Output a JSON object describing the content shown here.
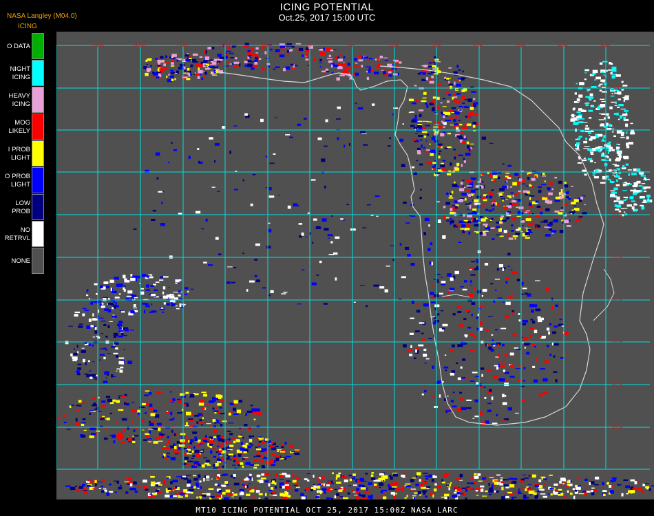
{
  "header": {
    "title": "ICING POTENTIAL",
    "subtitle": "Oct.25, 2017 15:00 UTC",
    "producer": "NASA Langley (M04.0)"
  },
  "legend": {
    "title": "ICING",
    "items": [
      {
        "label": "O DATA",
        "color": "#00b000"
      },
      {
        "label": "NIGHT\nICING",
        "color": "#00ffff"
      },
      {
        "label": "HEAVY\nICING",
        "color": "#e8a0d8"
      },
      {
        "label": "MOG\nLIKELY",
        "color": "#ff0000"
      },
      {
        "label": "I PROB\nLIGHT",
        "color": "#ffff00"
      },
      {
        "label": "O PROB\nLIGHT",
        "color": "#0000ff"
      },
      {
        "label": "LOW\nPROB",
        "color": "#000080"
      },
      {
        "label": "NO\nRETRVL",
        "color": "#ffffff"
      },
      {
        "label": "NONE",
        "color": "#505050"
      }
    ]
  },
  "map": {
    "background": "#505050",
    "grid_color": "#00e0e0",
    "coast_color": "#d8d8d8",
    "top_labels": [
      "25W",
      "20W",
      "15W",
      "10W",
      "5W",
      "0",
      "5E",
      "10E",
      "15E",
      "20E",
      "25E",
      "30E",
      "35E"
    ],
    "right_labels": [
      "5N",
      "0",
      "5S",
      "10S",
      "15S",
      "20S",
      "25S",
      "30S",
      "35S"
    ]
  },
  "footer": "MT10   ICING POTENTIAL    OCT 25, 2017 15:00Z   NASA LARC"
}
